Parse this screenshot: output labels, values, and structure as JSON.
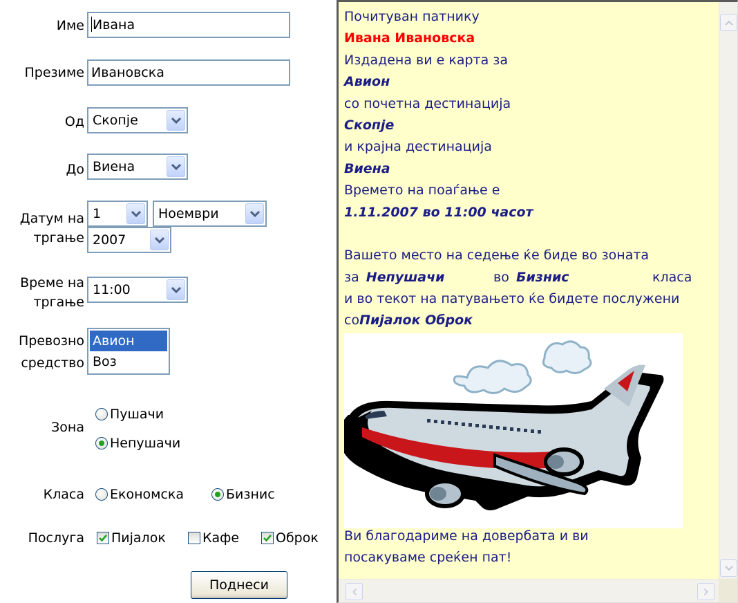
{
  "form": {
    "first_name": {
      "label": "Име",
      "value": "Ивана"
    },
    "last_name": {
      "label": "Презиме",
      "value": "Ивановска"
    },
    "from": {
      "label": "Од",
      "value": "Скопје"
    },
    "to": {
      "label": "До",
      "value": "Виена"
    },
    "departure_date": {
      "label_line1": "Датум на",
      "label_line2": "тргање",
      "day": "1",
      "month": "Ноември",
      "year": "2007"
    },
    "departure_time": {
      "label_line1": "Време на",
      "label_line2": "тргање",
      "value": "11:00"
    },
    "transport": {
      "label_line1": "Превозно",
      "label_line2": "средство",
      "options": [
        "Авион",
        "Воз"
      ],
      "selected": "Авион"
    },
    "zone": {
      "label": "Зона",
      "options": [
        "Пушачи",
        "Непушачи"
      ],
      "selected": "Непушачи"
    },
    "class": {
      "label": "Класа",
      "options": [
        "Економска",
        "Бизнис"
      ],
      "selected": "Бизнис"
    },
    "service": {
      "label": "Послуга",
      "options": [
        "Пијалок",
        "Кафе",
        "Оброк"
      ],
      "checked": [
        "Пијалок",
        "Оброк"
      ]
    },
    "submit_label": "Поднеси"
  },
  "ticket": {
    "greeting": "Почитуван патнику",
    "name": "Ивана Ивановска",
    "issued": "Издадена ви е карта за",
    "transport": "Авион",
    "start_text": "со почетна дестинација",
    "start": "Скопје",
    "end_text": "и крајна дестинација",
    "end": "Виена",
    "time_text": "Времето на поаѓање е",
    "time": "1.11.2007 во 11:00 часот",
    "seat_text": "Вашето место на седење ќе биде во зоната",
    "for": "за",
    "zone": "Непушачи",
    "in": "во",
    "class": "Бизнис",
    "class_word": "класа",
    "service_text": "и во текот на патувањето ќе бидете послужени",
    "with": "со",
    "services": "Пијалок Оброк",
    "thanks_line1": "Ви благодариме на довербата и ви",
    "thanks_line2": "посакуваме среќен пат!"
  },
  "colors": {
    "panel_bg": "#ffffcc",
    "text_blue": "#1b1d86",
    "name_red": "#ff0000",
    "select_highlight": "#316ac5",
    "radio_green": "#21a121"
  },
  "icons": [
    "chevron-down-icon",
    "chevron-up-icon",
    "chevron-left-icon",
    "chevron-right-icon",
    "airplane-illustration"
  ]
}
